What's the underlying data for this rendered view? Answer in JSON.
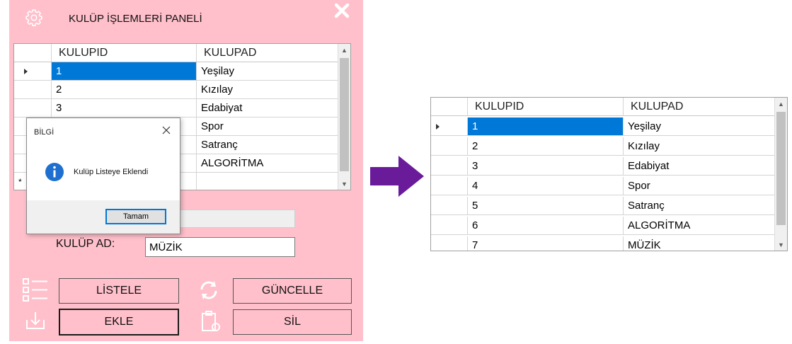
{
  "panel": {
    "title": "KULÜP İŞLEMLERİ PANELİ"
  },
  "grid_left": {
    "columns": [
      "KULUPID",
      "KULUPAD"
    ],
    "rows": [
      {
        "id": "1",
        "name": "Yeşilay"
      },
      {
        "id": "2",
        "name": "Kızılay"
      },
      {
        "id": "3",
        "name": "Edabiyat"
      },
      {
        "id": "",
        "name": "Spor"
      },
      {
        "id": "",
        "name": "Satranç"
      },
      {
        "id": "",
        "name": "ALGORİTMA"
      }
    ],
    "new_row_marker": "*"
  },
  "form": {
    "kulup_id_value": "",
    "kulup_ad_label": "KULÜP AD:",
    "kulup_ad_value": "MÜZİK"
  },
  "buttons": {
    "listele": "LİSTELE",
    "guncelle": "GÜNCELLE",
    "ekle": "EKLE",
    "sil": "SİL"
  },
  "messagebox": {
    "title": "BİLGİ",
    "text": "Kulüp Listeye Eklendi",
    "ok": "Tamam"
  },
  "grid_right": {
    "columns": [
      "KULUPID",
      "KULUPAD"
    ],
    "rows": [
      {
        "id": "1",
        "name": "Yeşilay"
      },
      {
        "id": "2",
        "name": "Kızılay"
      },
      {
        "id": "3",
        "name": "Edabiyat"
      },
      {
        "id": "4",
        "name": "Spor"
      },
      {
        "id": "5",
        "name": "Satranç"
      },
      {
        "id": "6",
        "name": "ALGORİTMA"
      },
      {
        "id": "7",
        "name": "MÜZİK"
      }
    ]
  },
  "colors": {
    "panel_bg": "#ffc0cb",
    "selection": "#0078d7",
    "arrow": "#6a1b9a",
    "close_icon": "#ffffff"
  },
  "icons": [
    "gear-icon",
    "close-icon",
    "list-icon",
    "refresh-icon",
    "download-icon",
    "clipboard-icon",
    "info-icon",
    "right-arrow-icon"
  ]
}
